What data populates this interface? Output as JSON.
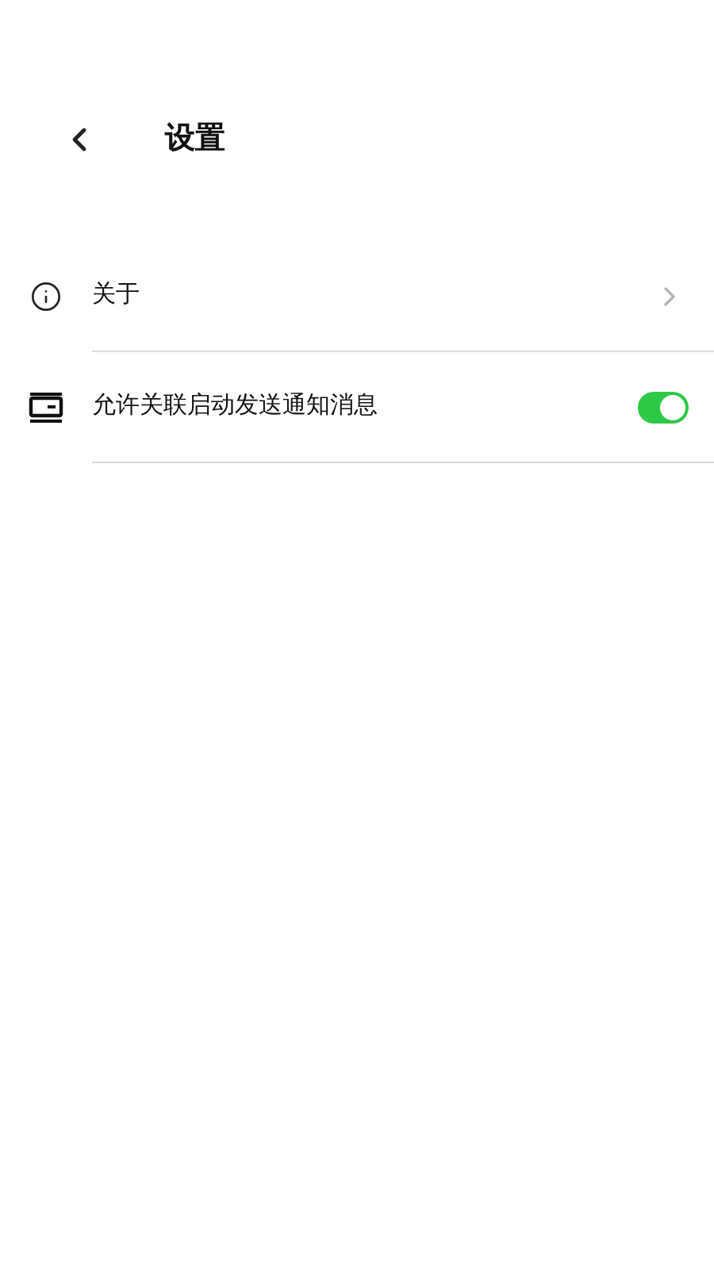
{
  "header": {
    "title": "设置"
  },
  "items": [
    {
      "kind": "link",
      "label": "关于"
    },
    {
      "kind": "toggle",
      "label": "允许关联启动发送通知消息",
      "on": true
    }
  ]
}
